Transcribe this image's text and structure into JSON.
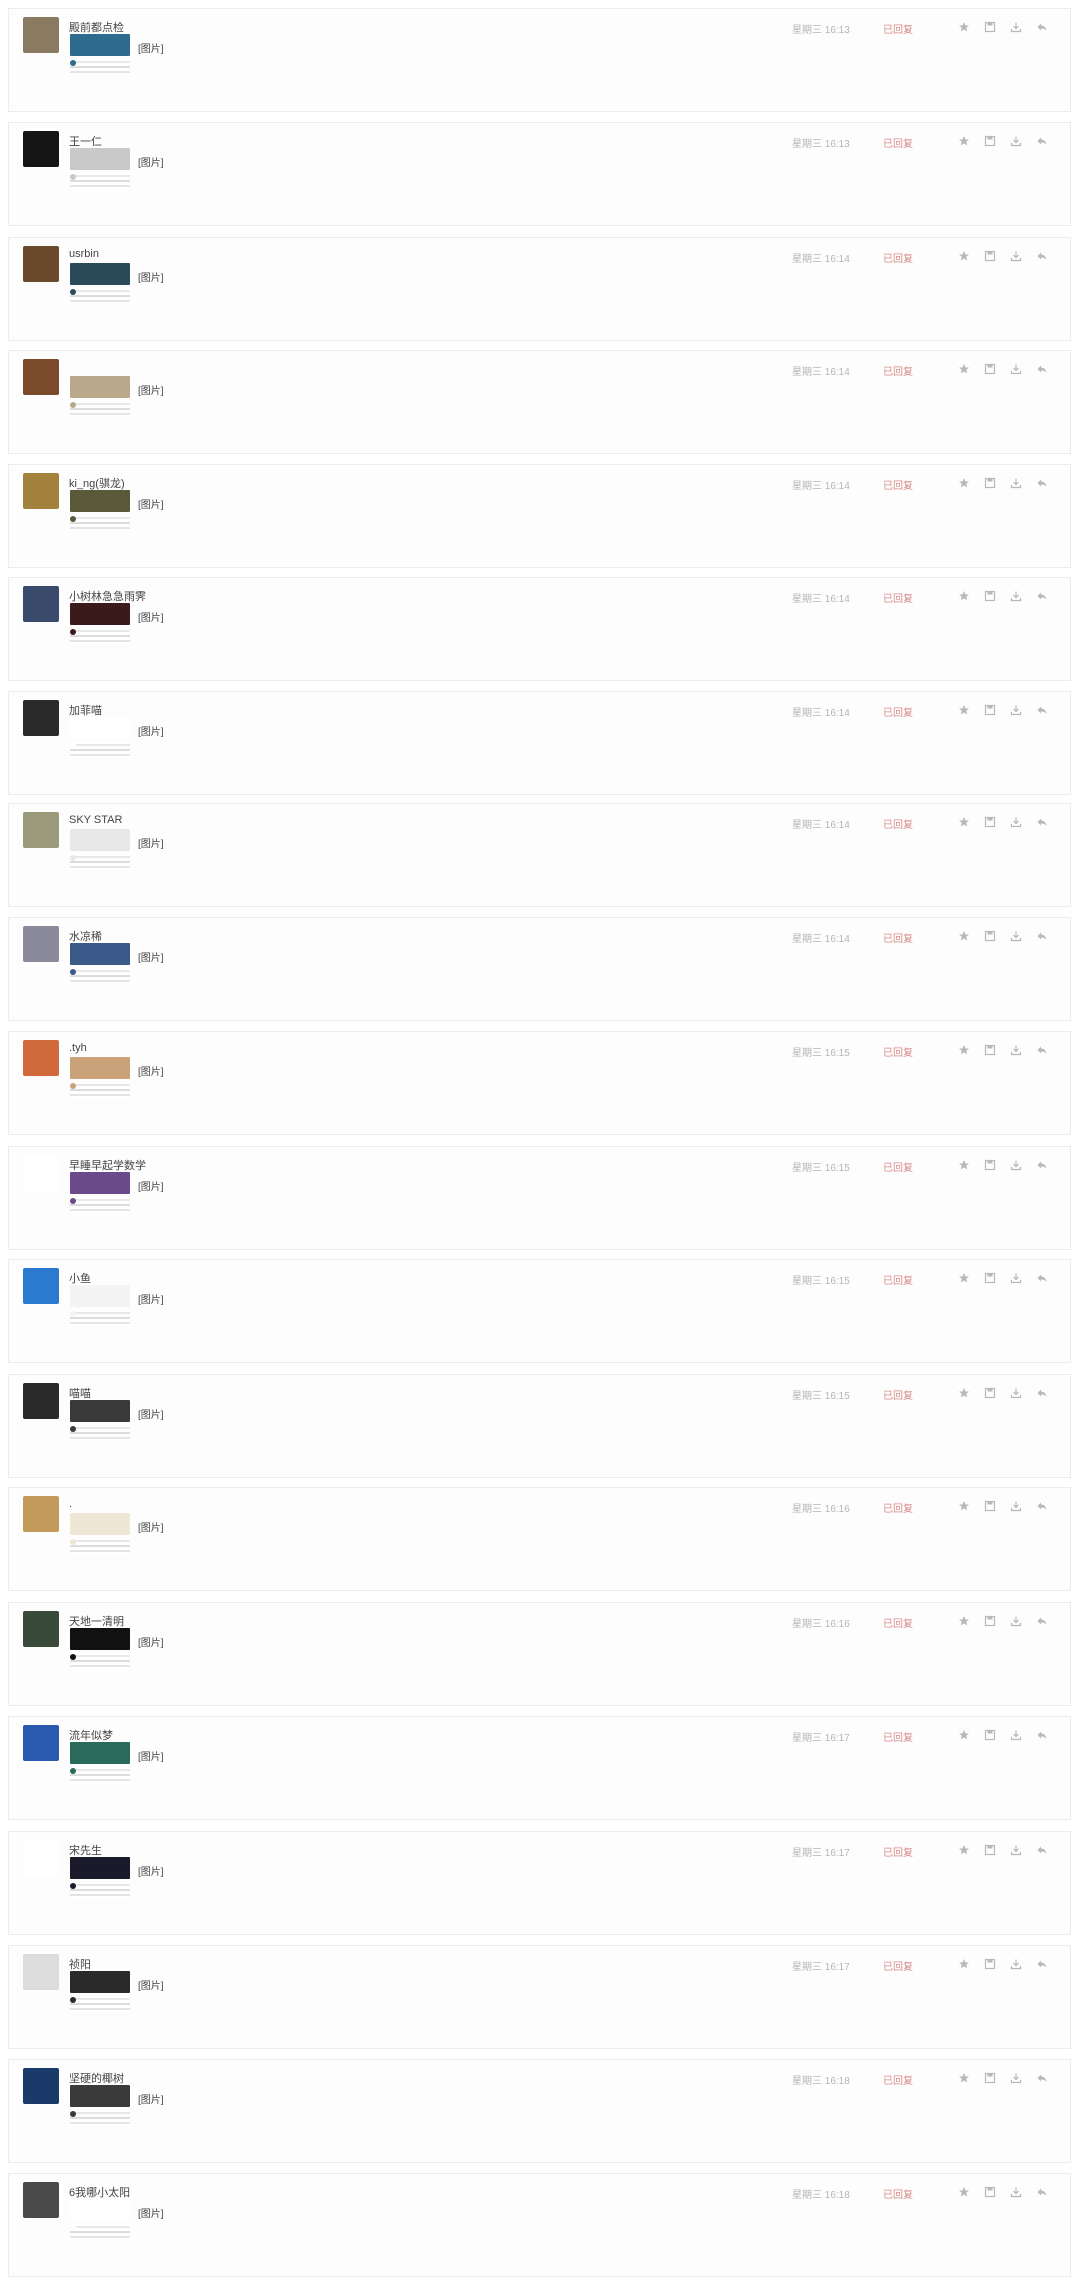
{
  "messages": [
    {
      "name": "殿前都点检",
      "image_label": "[图片]",
      "time": "星期三 16:13",
      "status": "已回复",
      "avatar_color": "#8a7a62",
      "thumb_color": "#2d6b8f"
    },
    {
      "name": "王一仁",
      "image_label": "[图片]",
      "time": "星期三 16:13",
      "status": "已回复",
      "avatar_color": "#151515",
      "thumb_color": "#c9c9c9"
    },
    {
      "name": "usrbin",
      "image_label": "[图片]",
      "time": "星期三 16:14",
      "status": "已回复",
      "avatar_color": "#6a4a2a",
      "thumb_color": "#2b4a5a"
    },
    {
      "name": "",
      "image_label": "[图片]",
      "time": "星期三 16:14",
      "status": "已回复",
      "avatar_color": "#7a4a2a",
      "thumb_color": "#b9a98a"
    },
    {
      "name": "ki_ng(骐龙)",
      "image_label": "[图片]",
      "time": "星期三 16:14",
      "status": "已回复",
      "avatar_color": "#a3823d",
      "thumb_color": "#5a5a3a"
    },
    {
      "name": "小树林急急雨霁",
      "image_label": "[图片]",
      "time": "星期三 16:14",
      "status": "已回复",
      "avatar_color": "#3a4a6a",
      "thumb_color": "#3a1a1a"
    },
    {
      "name": "加菲喵",
      "image_label": "[图片]",
      "time": "星期三 16:14",
      "status": "已回复",
      "avatar_color": "#2a2a2a",
      "thumb_color": "#ffffff"
    },
    {
      "name": "SKY STAR",
      "image_label": "[图片]",
      "time": "星期三 16:14",
      "status": "已回复",
      "avatar_color": "#9a9a7a",
      "thumb_color": "#e8e8e8"
    },
    {
      "name": "水凉稀",
      "image_label": "[图片]",
      "time": "星期三 16:14",
      "status": "已回复",
      "avatar_color": "#8a8a9a",
      "thumb_color": "#3a5a8a"
    },
    {
      "name": ".tyh",
      "image_label": "[图片]",
      "time": "星期三 16:15",
      "status": "已回复",
      "avatar_color": "#d06a3a",
      "thumb_color": "#caa27a"
    },
    {
      "name": "早睡早起学数学",
      "image_label": "[图片]",
      "time": "星期三 16:15",
      "status": "已回复",
      "avatar_color": "#ffffff",
      "thumb_color": "#6a4a8a"
    },
    {
      "name": "小鱼",
      "image_label": "[图片]",
      "time": "星期三 16:15",
      "status": "已回复",
      "avatar_color": "#2a7ad0",
      "thumb_color": "#f4f4f4"
    },
    {
      "name": "喵喵",
      "image_label": "[图片]",
      "time": "星期三 16:15",
      "status": "已回复",
      "avatar_color": "#2a2a2a",
      "thumb_color": "#3a3a3a"
    },
    {
      "name": ".",
      "image_label": "[图片]",
      "time": "星期三 16:16",
      "status": "已回复",
      "avatar_color": "#c49a5a",
      "thumb_color": "#efe7d6"
    },
    {
      "name": "天地一清明",
      "image_label": "[图片]",
      "time": "星期三 16:16",
      "status": "已回复",
      "avatar_color": "#3a4a3a",
      "thumb_color": "#111111"
    },
    {
      "name": "流年似梦",
      "image_label": "[图片]",
      "time": "星期三 16:17",
      "status": "已回复",
      "avatar_color": "#2a5ab0",
      "thumb_color": "#2a6a5a"
    },
    {
      "name": "宋先生",
      "image_label": "[图片]",
      "time": "星期三 16:17",
      "status": "已回复",
      "avatar_color": "#ffffff",
      "thumb_color": "#1a1a2a"
    },
    {
      "name": "祯阳",
      "image_label": "[图片]",
      "time": "星期三 16:17",
      "status": "已回复",
      "avatar_color": "#dcdcdc",
      "thumb_color": "#2a2a2a"
    },
    {
      "name": "坚硬的椰树",
      "image_label": "[图片]",
      "time": "星期三 16:18",
      "status": "已回复",
      "avatar_color": "#1a3a6a",
      "thumb_color": "#3a3a3a"
    },
    {
      "name": "6我哪小太阳",
      "image_label": "[图片]",
      "time": "星期三 16:18",
      "status": "已回复",
      "avatar_color": "#4a4a4a",
      "thumb_color": "#ffffff"
    }
  ],
  "icons": {
    "star": "star-icon",
    "save": "save-icon",
    "download": "download-icon",
    "reply": "reply-icon"
  },
  "colors": {
    "status": "#d98a8a",
    "time": "#b5b5b5",
    "icon": "#b8b8b8",
    "border": "#ececec"
  }
}
